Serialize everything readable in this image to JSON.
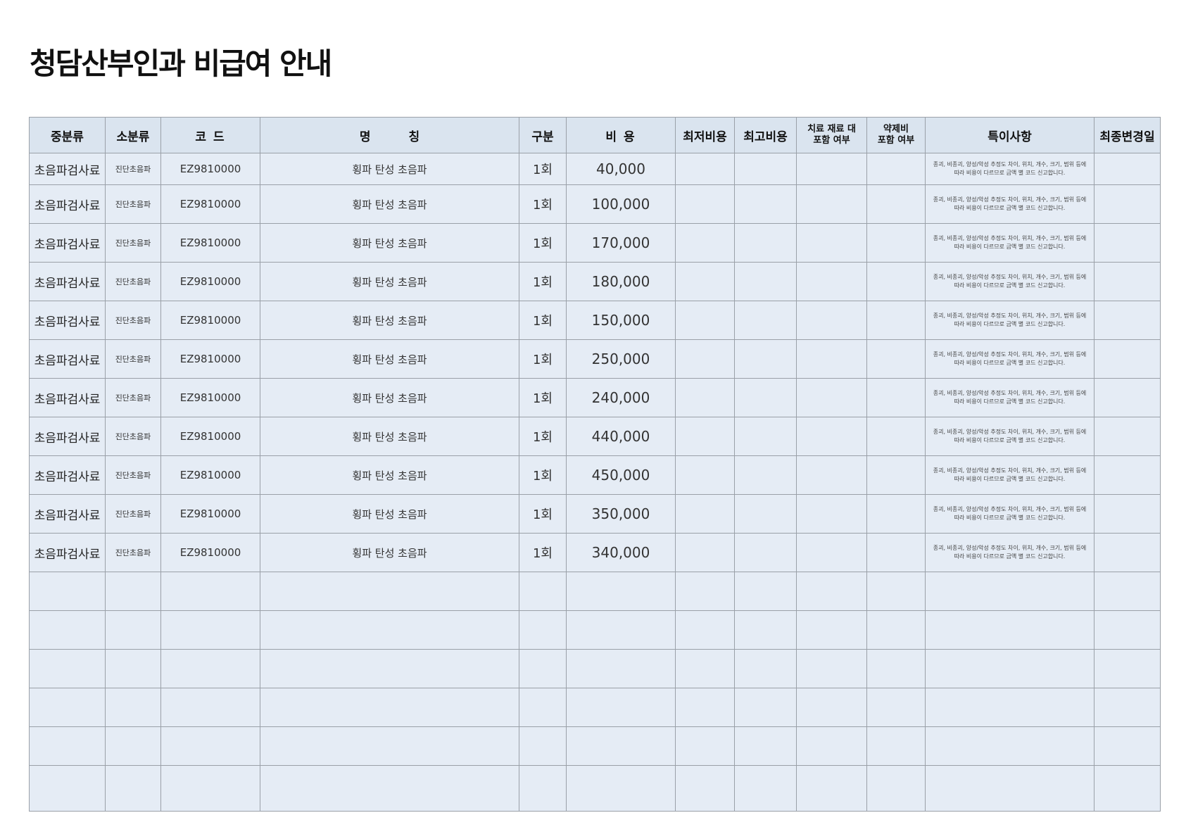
{
  "title": "청담산부인과 비급여 안내",
  "table": {
    "headers": {
      "mid_category": "중분류",
      "sub_category": "소분류",
      "code": "코 드",
      "name": "명 칭",
      "unit": "구분",
      "cost": "비 용",
      "min_cost": "최저비용",
      "max_cost": "최고비용",
      "material_line1": "치료 재료 대",
      "material_line2": "포함 여부",
      "drug_line1": "약제비",
      "drug_line2": "포함 여부",
      "note": "특이사항",
      "last_changed": "최종변경일"
    },
    "rows": [
      {
        "mid_category": "초음파검사료",
        "sub_category": "진단초음파",
        "code": "EZ9810000",
        "name": "횡파 탄성 초음파",
        "unit": "1회",
        "cost": "40,000",
        "min_cost": "",
        "max_cost": "",
        "material": "",
        "drug": "",
        "note_line1": "종괴, 비종괴, 양성/악성 추정도 차이, 위치, 개수, 크기, 범위 등에",
        "note_line2": "따라 비용이 다르므로 금액 별 코드 신고합니다.",
        "last_changed": ""
      },
      {
        "mid_category": "초음파검사료",
        "sub_category": "진단초음파",
        "code": "EZ9810000",
        "name": "횡파 탄성 초음파",
        "unit": "1회",
        "cost": "100,000",
        "min_cost": "",
        "max_cost": "",
        "material": "",
        "drug": "",
        "note_line1": "종괴, 비종괴, 양성/악성 추정도 차이, 위치, 개수, 크기, 범위 등에",
        "note_line2": "따라 비용이 다르므로 금액 별 코드 신고합니다.",
        "last_changed": ""
      },
      {
        "mid_category": "초음파검사료",
        "sub_category": "진단초음파",
        "code": "EZ9810000",
        "name": "횡파 탄성 초음파",
        "unit": "1회",
        "cost": "170,000",
        "min_cost": "",
        "max_cost": "",
        "material": "",
        "drug": "",
        "note_line1": "종괴, 비종괴, 양성/악성 추정도 차이, 위치, 개수, 크기, 범위 등에",
        "note_line2": "따라 비용이 다르므로 금액 별 코드 신고합니다.",
        "last_changed": ""
      },
      {
        "mid_category": "초음파검사료",
        "sub_category": "진단초음파",
        "code": "EZ9810000",
        "name": "횡파 탄성 초음파",
        "unit": "1회",
        "cost": "180,000",
        "min_cost": "",
        "max_cost": "",
        "material": "",
        "drug": "",
        "note_line1": "종괴, 비종괴, 양성/악성 추정도 차이, 위치, 개수, 크기, 범위 등에",
        "note_line2": "따라 비용이 다르므로 금액 별 코드 신고합니다.",
        "last_changed": ""
      },
      {
        "mid_category": "초음파검사료",
        "sub_category": "진단초음파",
        "code": "EZ9810000",
        "name": "횡파 탄성 초음파",
        "unit": "1회",
        "cost": "150,000",
        "min_cost": "",
        "max_cost": "",
        "material": "",
        "drug": "",
        "note_line1": "종괴, 비종괴, 양성/악성 추정도 차이, 위치, 개수, 크기, 범위 등에",
        "note_line2": "따라 비용이 다르므로 금액 별 코드 신고합니다.",
        "last_changed": ""
      },
      {
        "mid_category": "초음파검사료",
        "sub_category": "진단초음파",
        "code": "EZ9810000",
        "name": "횡파 탄성 초음파",
        "unit": "1회",
        "cost": "250,000",
        "min_cost": "",
        "max_cost": "",
        "material": "",
        "drug": "",
        "note_line1": "종괴, 비종괴, 양성/악성 추정도 차이, 위치, 개수, 크기, 범위 등에",
        "note_line2": "따라 비용이 다르므로 금액 별 코드 신고합니다.",
        "last_changed": ""
      },
      {
        "mid_category": "초음파검사료",
        "sub_category": "진단초음파",
        "code": "EZ9810000",
        "name": "횡파 탄성 초음파",
        "unit": "1회",
        "cost": "240,000",
        "min_cost": "",
        "max_cost": "",
        "material": "",
        "drug": "",
        "note_line1": "종괴, 비종괴, 양성/악성 추정도 차이, 위치, 개수, 크기, 범위 등에",
        "note_line2": "따라 비용이 다르므로 금액 별 코드 신고합니다.",
        "last_changed": ""
      },
      {
        "mid_category": "초음파검사료",
        "sub_category": "진단초음파",
        "code": "EZ9810000",
        "name": "횡파 탄성 초음파",
        "unit": "1회",
        "cost": "440,000",
        "min_cost": "",
        "max_cost": "",
        "material": "",
        "drug": "",
        "note_line1": "종괴, 비종괴, 양성/악성 추정도 차이, 위치, 개수, 크기, 범위 등에",
        "note_line2": "따라 비용이 다르므로 금액 별 코드 신고합니다.",
        "last_changed": ""
      },
      {
        "mid_category": "초음파검사료",
        "sub_category": "진단초음파",
        "code": "EZ9810000",
        "name": "횡파 탄성 초음파",
        "unit": "1회",
        "cost": "450,000",
        "min_cost": "",
        "max_cost": "",
        "material": "",
        "drug": "",
        "note_line1": "종괴, 비종괴, 양성/악성 추정도 차이, 위치, 개수, 크기, 범위 등에",
        "note_line2": "따라 비용이 다르므로 금액 별 코드 신고합니다.",
        "last_changed": ""
      },
      {
        "mid_category": "초음파검사료",
        "sub_category": "진단초음파",
        "code": "EZ9810000",
        "name": "횡파 탄성 초음파",
        "unit": "1회",
        "cost": "350,000",
        "min_cost": "",
        "max_cost": "",
        "material": "",
        "drug": "",
        "note_line1": "종괴, 비종괴, 양성/악성 추정도 차이, 위치, 개수, 크기, 범위 등에",
        "note_line2": "따라 비용이 다르므로 금액 별 코드 신고합니다.",
        "last_changed": ""
      },
      {
        "mid_category": "초음파검사료",
        "sub_category": "진단초음파",
        "code": "EZ9810000",
        "name": "횡파 탄성 초음파",
        "unit": "1회",
        "cost": "340,000",
        "min_cost": "",
        "max_cost": "",
        "material": "",
        "drug": "",
        "note_line1": "종괴, 비종괴, 양성/악성 추정도 차이, 위치, 개수, 크기, 범위 등에",
        "note_line2": "따라 비용이 다르므로 금액 별 코드 신고합니다.",
        "last_changed": ""
      }
    ],
    "empty_rows": 6
  }
}
